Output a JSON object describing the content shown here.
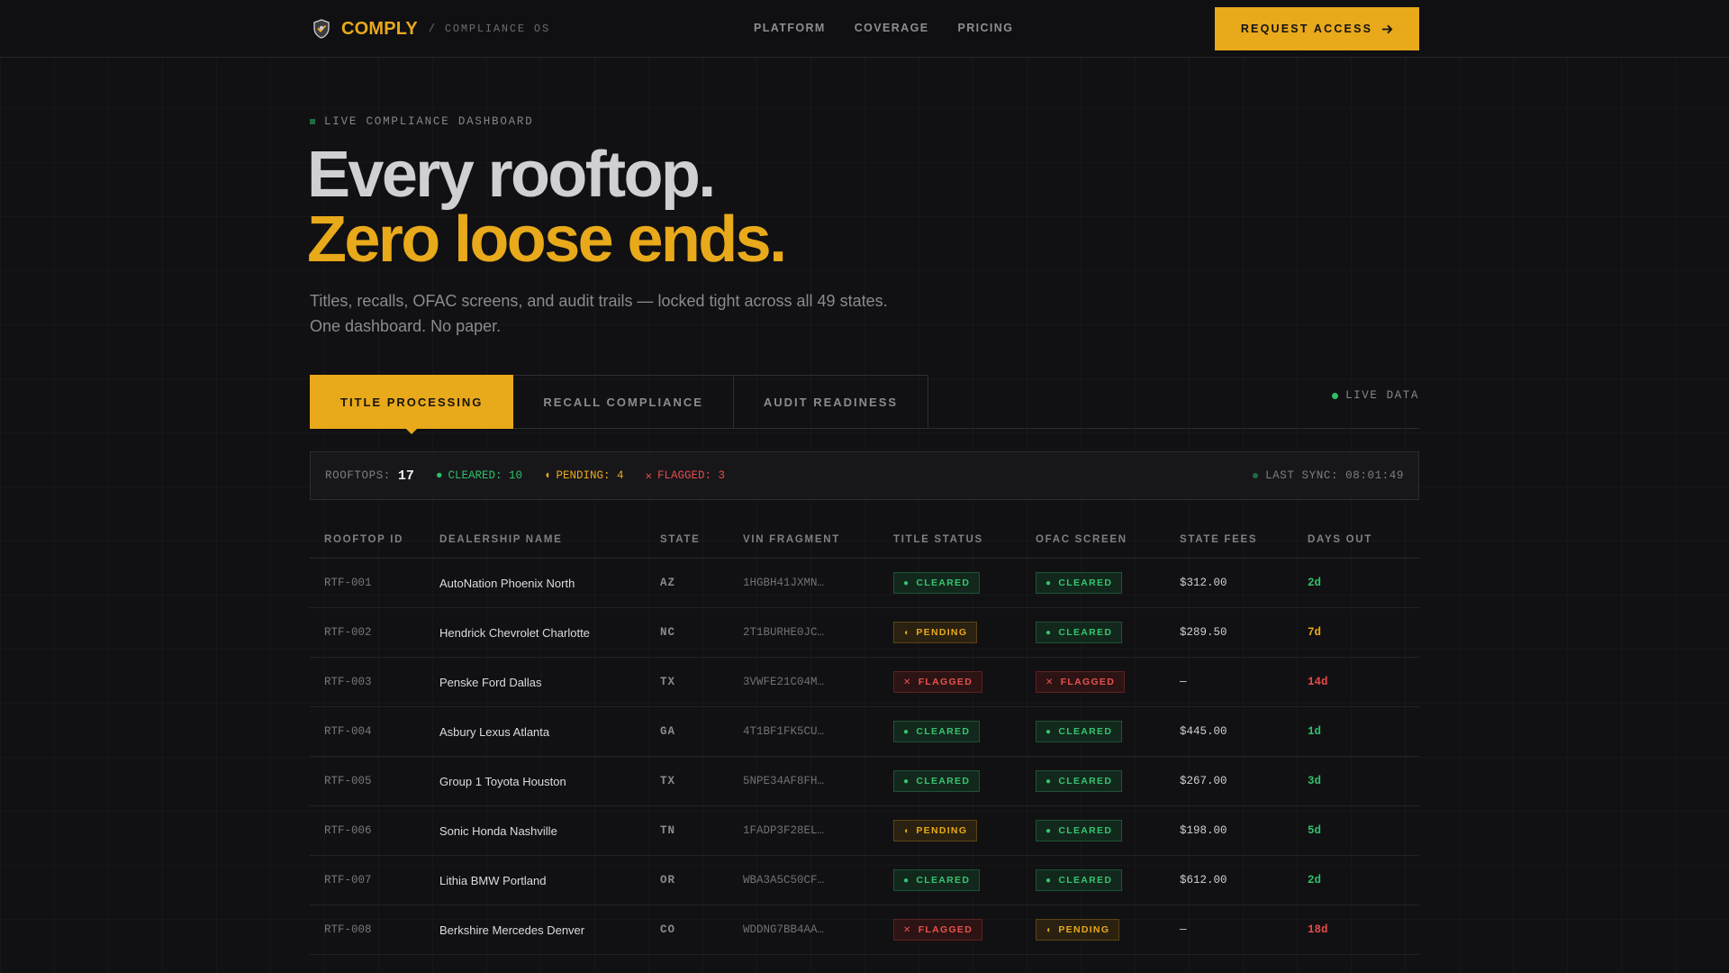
{
  "nav": {
    "brand": "COMPLY",
    "brand_sub": "/ COMPLIANCE OS",
    "links": [
      "PLATFORM",
      "COVERAGE",
      "PRICING"
    ],
    "cta": "REQUEST ACCESS"
  },
  "hero": {
    "eyebrow": "LIVE COMPLIANCE DASHBOARD",
    "title_line1": "Every rooftop.",
    "title_line2": "Zero loose ends.",
    "lede_line1": "Titles, recalls, OFAC screens, and audit trails — locked tight across all 49 states.",
    "lede_line2": "One dashboard. No paper."
  },
  "tabs": [
    {
      "label": "TITLE PROCESSING",
      "active": true
    },
    {
      "label": "RECALL COMPLIANCE",
      "active": false
    },
    {
      "label": "AUDIT READINESS",
      "active": false
    }
  ],
  "live_label": "LIVE DATA",
  "stats": {
    "rooftops_label": "ROOFTOPS:",
    "rooftops_count": "17",
    "cleared": "CLEARED: 10",
    "pending": "PENDING: 4",
    "flagged": "FLAGGED: 3",
    "sync": "LAST SYNC: 08:01:49"
  },
  "table": {
    "headers": [
      "ROOFTOP ID",
      "DEALERSHIP NAME",
      "STATE",
      "VIN FRAGMENT",
      "TITLE STATUS",
      "OFAC SCREEN",
      "STATE FEES",
      "DAYS OUT"
    ],
    "rows": [
      {
        "id": "RTF-001",
        "name": "AutoNation Phoenix North",
        "state": "AZ",
        "vin": "1HGBH41JXMN…",
        "title": "CLEARED",
        "ofac": "CLEARED",
        "fee": "$312.00",
        "days": "2d"
      },
      {
        "id": "RTF-002",
        "name": "Hendrick Chevrolet Charlotte",
        "state": "NC",
        "vin": "2T1BURHE0JC…",
        "title": "PENDING",
        "ofac": "CLEARED",
        "fee": "$289.50",
        "days": "7d"
      },
      {
        "id": "RTF-003",
        "name": "Penske Ford Dallas",
        "state": "TX",
        "vin": "3VWFE21C04M…",
        "title": "FLAGGED",
        "ofac": "FLAGGED",
        "fee": "—",
        "days": "14d"
      },
      {
        "id": "RTF-004",
        "name": "Asbury Lexus Atlanta",
        "state": "GA",
        "vin": "4T1BF1FK5CU…",
        "title": "CLEARED",
        "ofac": "CLEARED",
        "fee": "$445.00",
        "days": "1d"
      },
      {
        "id": "RTF-005",
        "name": "Group 1 Toyota Houston",
        "state": "TX",
        "vin": "5NPE34AF8FH…",
        "title": "CLEARED",
        "ofac": "CLEARED",
        "fee": "$267.00",
        "days": "3d"
      },
      {
        "id": "RTF-006",
        "name": "Sonic Honda Nashville",
        "state": "TN",
        "vin": "1FADP3F28EL…",
        "title": "PENDING",
        "ofac": "CLEARED",
        "fee": "$198.00",
        "days": "5d"
      },
      {
        "id": "RTF-007",
        "name": "Lithia BMW Portland",
        "state": "OR",
        "vin": "WBA3A5C50CF…",
        "title": "CLEARED",
        "ofac": "CLEARED",
        "fee": "$612.00",
        "days": "2d"
      },
      {
        "id": "RTF-008",
        "name": "Berkshire Mercedes Denver",
        "state": "CO",
        "vin": "WDDNG7BB4AA…",
        "title": "FLAGGED",
        "ofac": "PENDING",
        "fee": "—",
        "days": "18d"
      }
    ]
  },
  "colors": {
    "accent": "#e8a91a",
    "cleared": "#2fbf6a",
    "pending": "#e8a91a",
    "flagged": "#e24b4b",
    "background": "#111113"
  },
  "icons": {
    "brand": "shield-logo-icon",
    "cta": "arrow-right-icon",
    "cleared": "dot-icon",
    "pending": "half-diamond-icon",
    "flagged": "x-icon"
  }
}
